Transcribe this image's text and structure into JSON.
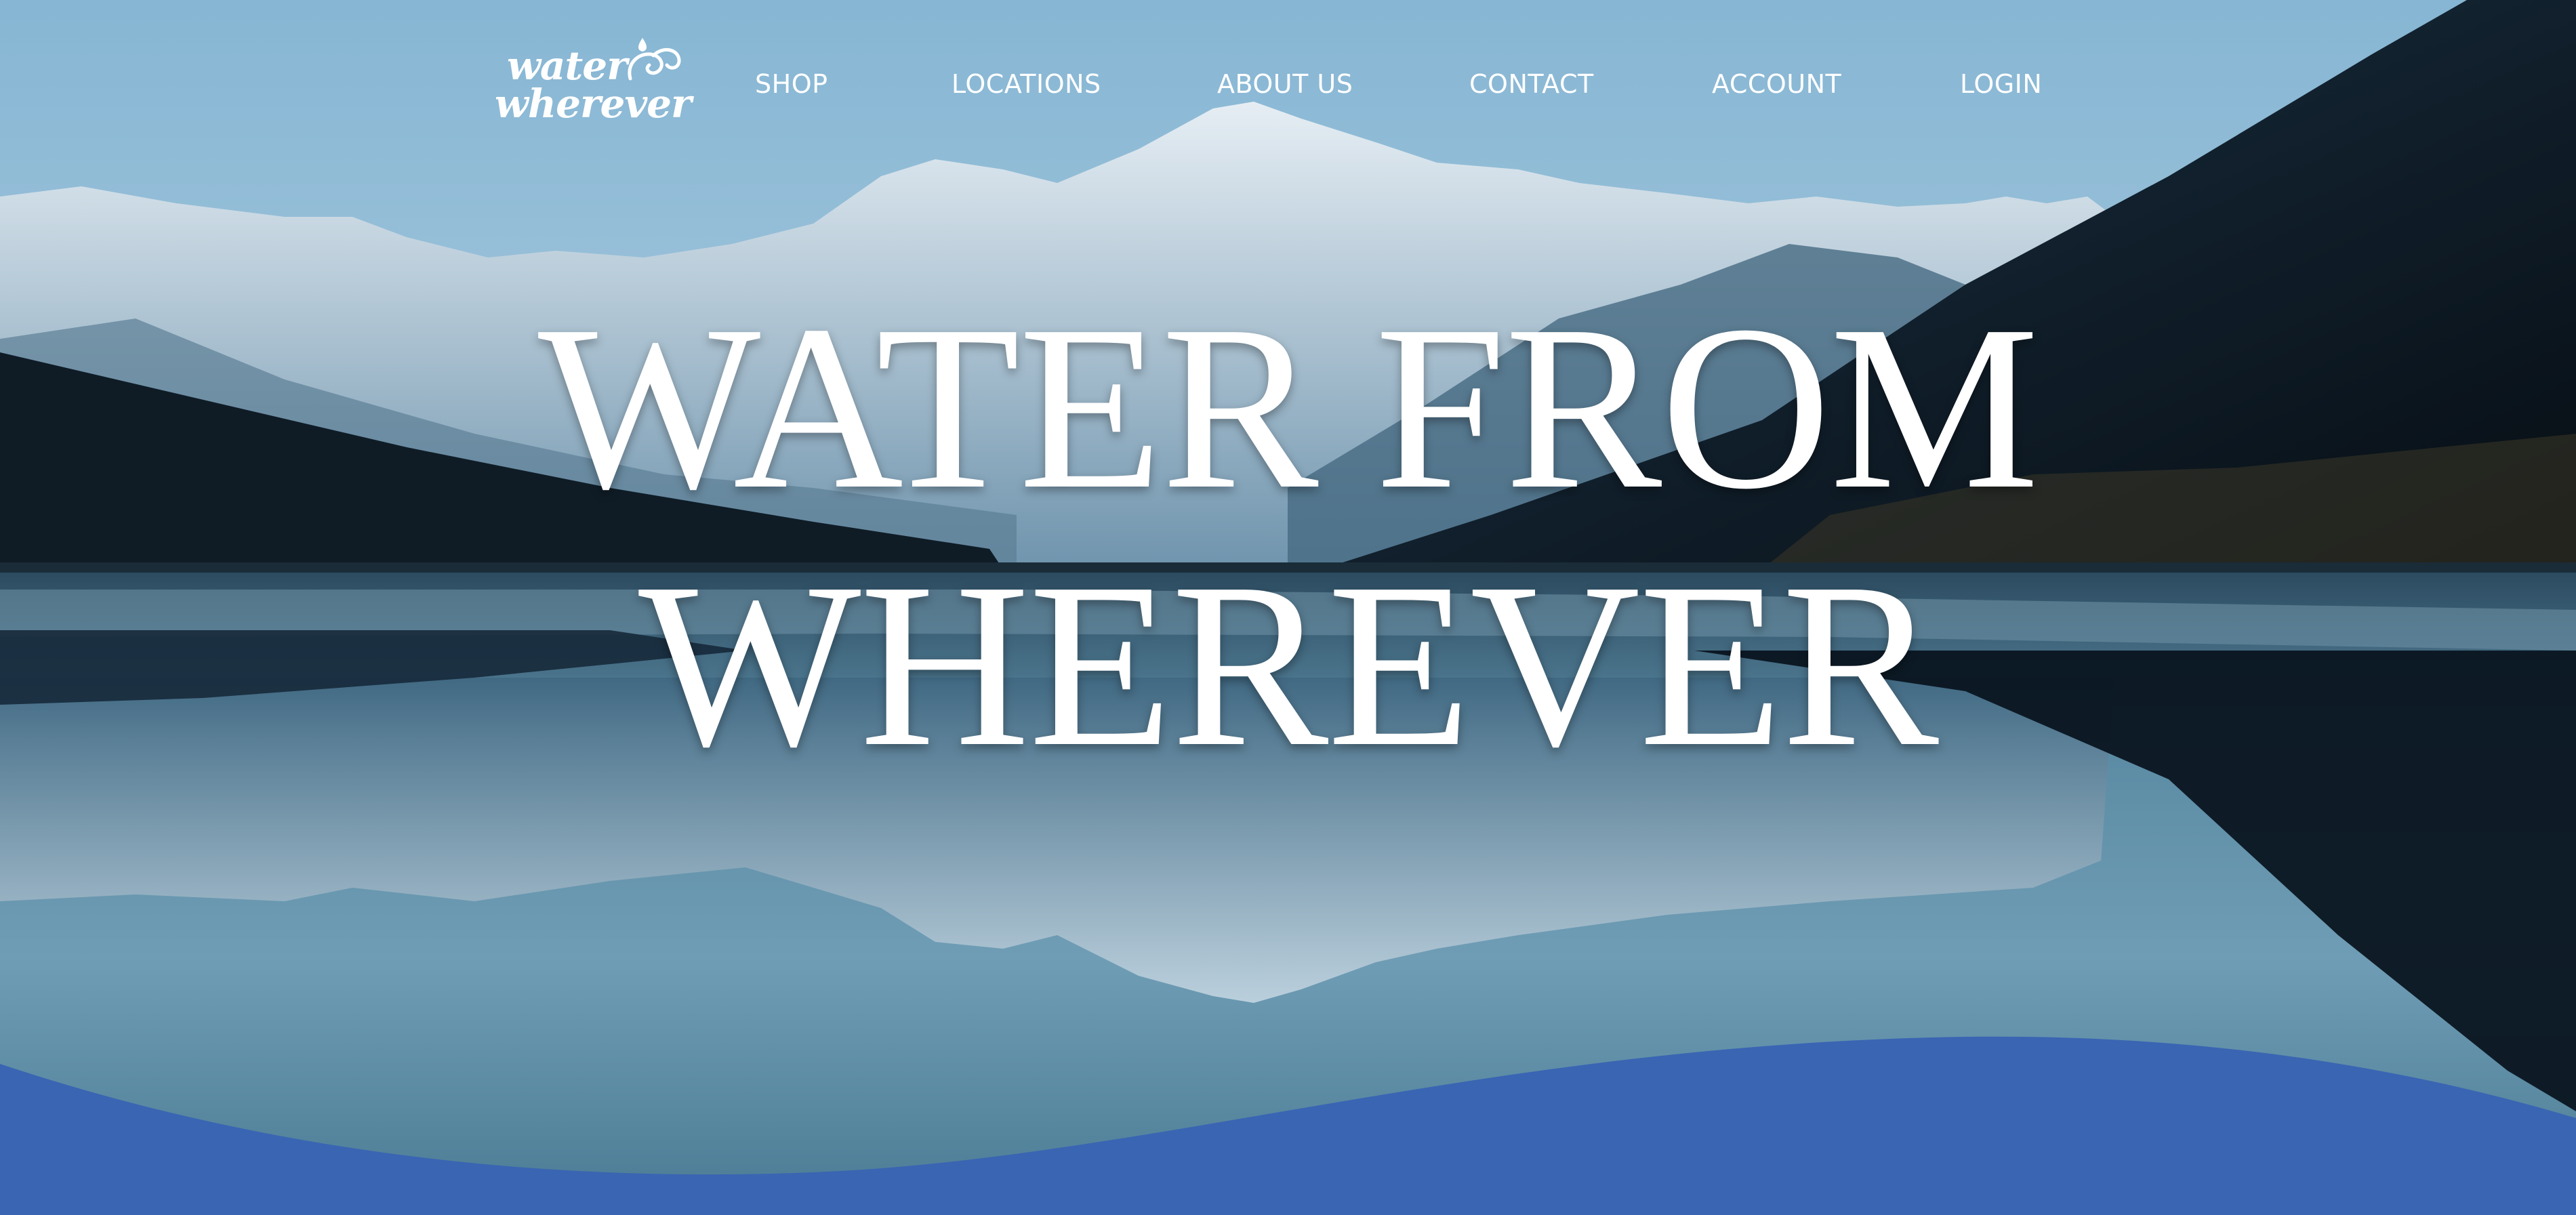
{
  "logo": {
    "line1": "water",
    "line2": "wherever"
  },
  "nav": {
    "items": [
      {
        "label": "SHOP"
      },
      {
        "label": "LOCATIONS"
      },
      {
        "label": "ABOUT US"
      },
      {
        "label": "CONTACT"
      },
      {
        "label": "ACCOUNT"
      },
      {
        "label": "LOGIN"
      }
    ]
  },
  "hero": {
    "title_line1": "WATER FROM",
    "title_line2": "WHEREVER",
    "background": "mountain-lake-reflection-image"
  },
  "colors": {
    "sky": "#7fb0cf",
    "mountain_snow": "#dbe6ee",
    "water": "#4f7f99",
    "dark_slope": "#0d1a24",
    "wave_accent": "#3a65b3",
    "text": "#ffffff"
  }
}
